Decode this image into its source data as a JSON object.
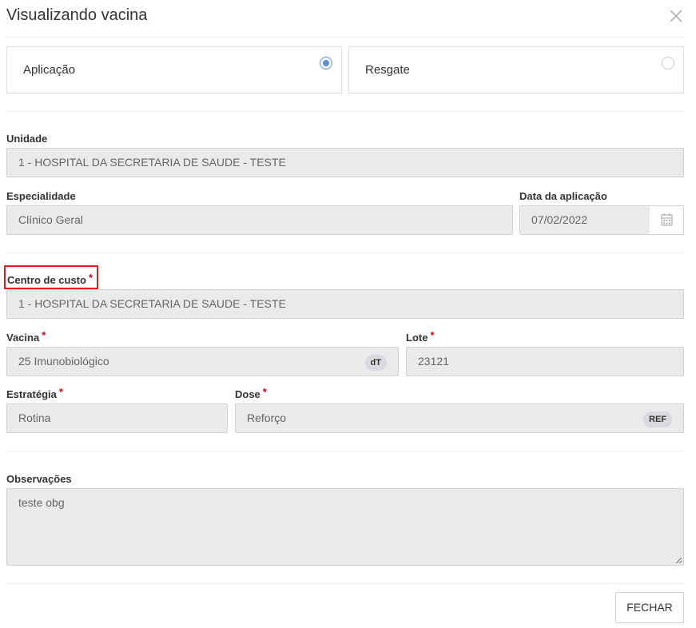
{
  "modal": {
    "title": "Visualizando vacina",
    "close_icon": "close-icon"
  },
  "type_options": [
    {
      "label": "Aplicação",
      "selected": true
    },
    {
      "label": "Resgate",
      "selected": false
    }
  ],
  "fields": {
    "unidade": {
      "label": "Unidade",
      "value": "1 - HOSPITAL DA SECRETARIA DE SAUDE - TESTE"
    },
    "especialidade": {
      "label": "Especialidade",
      "value": "Clínico Geral"
    },
    "data_aplicacao": {
      "label": "Data da aplicação",
      "value": "07/02/2022",
      "icon": "calendar-icon"
    },
    "centro_custo": {
      "label": "Centro de custo",
      "required_mark": "*",
      "value": "1 - HOSPITAL DA SECRETARIA DE SAUDE - TESTE"
    },
    "vacina": {
      "label": "Vacina",
      "required_mark": "*",
      "value": "25 Imunobiológico",
      "badge": "dT"
    },
    "lote": {
      "label": "Lote",
      "required_mark": "*",
      "value": "23121"
    },
    "estrategia": {
      "label": "Estratégia",
      "required_mark": "*",
      "value": "Rotina"
    },
    "dose": {
      "label": "Dose",
      "required_mark": "*",
      "value": "Reforço",
      "badge": "REF"
    },
    "observacoes": {
      "label": "Observações",
      "value": "teste obg"
    }
  },
  "footer": {
    "close_button": "FECHAR"
  },
  "colors": {
    "accent": "#5b8ed6",
    "required": "#d0021b",
    "highlight": "#e31b1b",
    "input_bg": "#e9eaec"
  }
}
